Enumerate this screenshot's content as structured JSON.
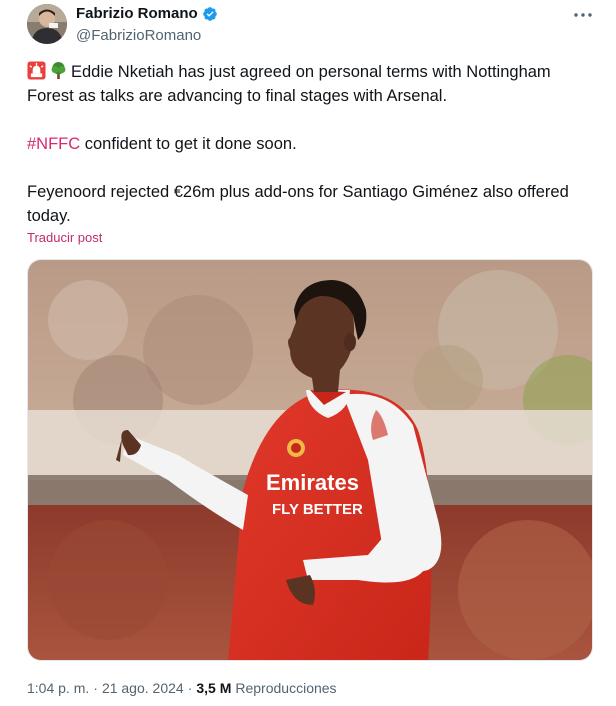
{
  "author": {
    "display_name": "Fabrizio Romano",
    "handle": "@FabrizioRomano",
    "verified": true
  },
  "tweet": {
    "paragraphs": [
      {
        "emojis": [
          "rotating-light-emoji",
          "tree-emoji"
        ],
        "text": "Eddie Nketiah has just agreed on personal terms with Nottingham Forest as talks are advancing to final stages with Arsenal."
      },
      {
        "hashtag": "#NFFC",
        "text": " confident to get it done soon."
      },
      {
        "text": "Feyenoord rejected €26m plus add-ons for Santiago Giménez also offered today."
      }
    ],
    "translate_label": "Traducir post"
  },
  "media": {
    "shirt_text_line1": "Emirates",
    "shirt_text_line2": "FLY BETTER"
  },
  "meta": {
    "time": "1:04 p. m.",
    "separator": "·",
    "date": "21 ago. 2024",
    "views_count": "3,5 M",
    "views_label": "Reproducciones"
  },
  "colors": {
    "accent": "#d6286f",
    "verified": "#1d9bf0",
    "secondary_text": "#536471"
  },
  "icons": [
    "verified-badge-icon",
    "more-options-icon"
  ]
}
